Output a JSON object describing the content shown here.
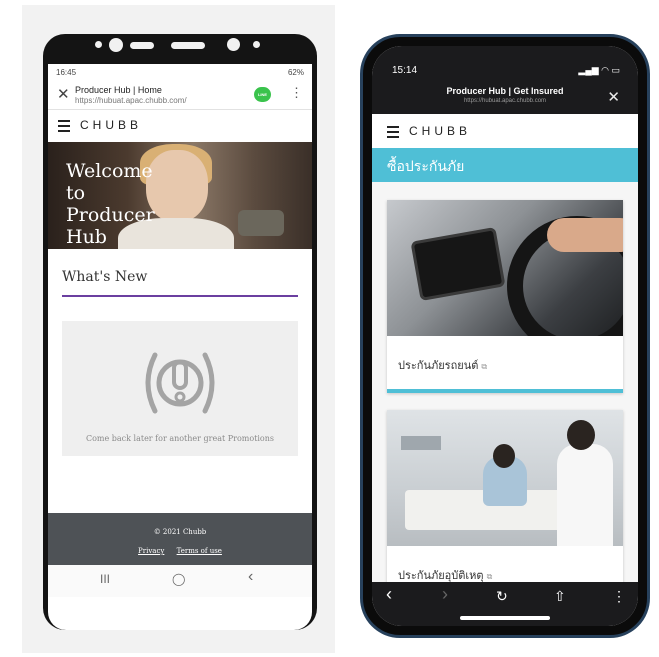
{
  "android": {
    "status_time": "16:45",
    "status_right": "62%",
    "tab_title": "Producer Hub | Home",
    "url": "https://hubuat.apac.chubb.com/",
    "logo": "CHUBB",
    "hero_title": "Welcome to Producer Hub",
    "whats_new": "What's New",
    "promo_text": "Come back later for another great Promotions",
    "footer_copyright": "© 2021 Chubb",
    "footer_privacy": "Privacy",
    "footer_terms": "Terms of use",
    "nav_recents": "III",
    "nav_home": "◯",
    "nav_back": "‹"
  },
  "iphone": {
    "status_time": "15:14",
    "title": "Producer Hub | Get Insured",
    "url": "https://hubuat.apac.chubb.com",
    "logo": "CHUBB",
    "section_title": "ซื้อประกันภัย",
    "cards": [
      {
        "label": "ประกันภัยรถยนต์"
      },
      {
        "label": "ประกันภัยอุบัติเหตุ"
      }
    ],
    "toolbar": {
      "back": "‹",
      "forward": "›",
      "reload": "↻",
      "share": "⇧",
      "more": "⋮"
    }
  },
  "colors": {
    "purple_accent": "#6b3fa0",
    "teal_header": "#4fbfd6",
    "footer_gray": "#4e5256"
  }
}
